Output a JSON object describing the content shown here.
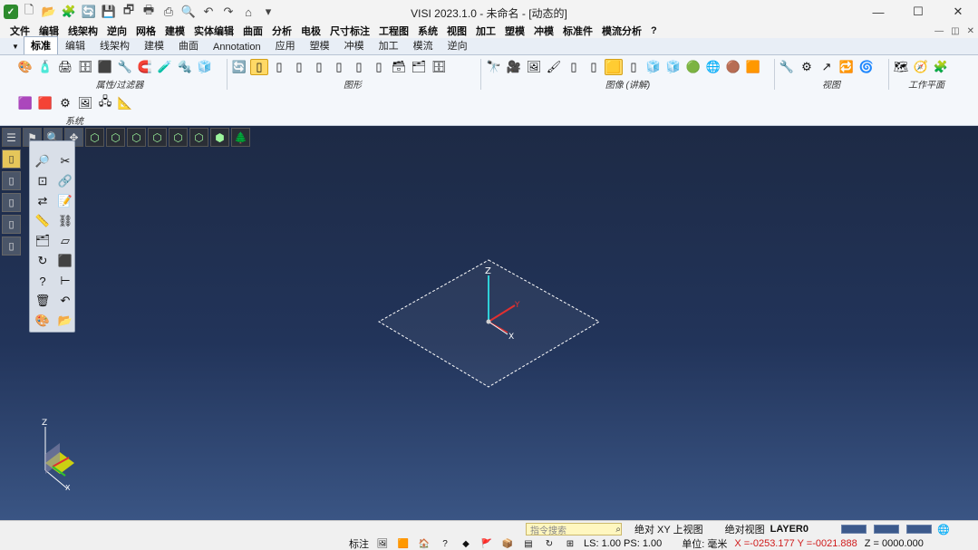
{
  "window": {
    "title": "VISI 2023.1.0 - 未命名 - [动态的]",
    "minimize_glyph": "—",
    "maximize_glyph": "☐",
    "close_glyph": "✕",
    "app_logo_glyph": "✓"
  },
  "quick_access": [
    {
      "name": "new-file-icon",
      "glyph": "🗋"
    },
    {
      "name": "open-icon",
      "glyph": "📂"
    },
    {
      "name": "import-icon",
      "glyph": "🧩"
    },
    {
      "name": "recent-icon",
      "glyph": "🔄"
    },
    {
      "name": "save-icon",
      "glyph": "💾"
    },
    {
      "name": "save-as-icon",
      "glyph": "🗗"
    },
    {
      "name": "print-icon",
      "glyph": "🖶"
    },
    {
      "name": "print-preview-icon",
      "glyph": "⎙"
    },
    {
      "name": "search-icon",
      "glyph": "🔍"
    },
    {
      "name": "undo-icon",
      "glyph": "↶"
    },
    {
      "name": "redo-icon",
      "glyph": "↷"
    },
    {
      "name": "home-icon",
      "glyph": "⌂"
    },
    {
      "name": "customize-icon",
      "glyph": "▾"
    }
  ],
  "menu": [
    "文件",
    "编辑",
    "线架构",
    "逆向",
    "网格",
    "建模",
    "实体编辑",
    "曲面",
    "分析",
    "电极",
    "尺寸标注",
    "工程图",
    "系统",
    "视图",
    "加工",
    "塑模",
    "冲模",
    "标准件",
    "模流分析",
    "?"
  ],
  "mdi_controls": [
    "—",
    "◫",
    "✕"
  ],
  "tabs": {
    "dropdown_glyph": "▼",
    "items": [
      "标准",
      "编辑",
      "线架构",
      "建模",
      "曲面",
      "Annotation",
      "应用",
      "塑模",
      "冲模",
      "加工",
      "模流",
      "逆向"
    ],
    "active_index": 0
  },
  "ribbon": {
    "groups": [
      {
        "label": "属性/过滤器",
        "icons": [
          "🎨",
          "🧴",
          "🖨",
          "🗄",
          "⬛",
          "🔧",
          "🧲",
          "🧪",
          "🔩",
          "🧊"
        ]
      },
      {
        "label": "图形",
        "icons": [
          "🔄",
          "▯",
          "▯",
          "▯",
          "▯",
          "▯",
          "▯",
          "▯",
          "🗃",
          "🗂",
          "🗄"
        ]
      },
      {
        "label": "图像 (讲解)",
        "icons": [
          "🔭",
          "🎥",
          "🖼",
          "🖌",
          "▯",
          "▯",
          "🟨",
          "▯",
          "🧊",
          "🧊",
          "🟢",
          "🌐",
          "🟤",
          "🟧"
        ]
      },
      {
        "label": "视图",
        "icons": [
          "🔧",
          "⚙",
          "↗",
          "🔁",
          "🌀"
        ]
      },
      {
        "label": "工作平面",
        "icons": [
          "🗺",
          "🧭",
          "🧩"
        ]
      }
    ],
    "system_group": {
      "label": "系统",
      "icons": [
        "🟪",
        "🟥",
        "⚙",
        "🖼",
        "🖧",
        "📐"
      ]
    }
  },
  "viewport": {
    "toolbar_icons": [
      {
        "name": "viewport-menu-icon",
        "glyph": "☰"
      },
      {
        "name": "flag-icon",
        "glyph": "⚑"
      },
      {
        "name": "zoom-icon",
        "glyph": "🔍"
      },
      {
        "name": "pan-icon",
        "glyph": "✥"
      },
      {
        "name": "view-top-icon",
        "glyph": "⬡"
      },
      {
        "name": "view-front-icon",
        "glyph": "⬡"
      },
      {
        "name": "view-side-icon",
        "glyph": "⬡"
      },
      {
        "name": "view-iso-icon",
        "glyph": "⬡"
      },
      {
        "name": "view-iso2-icon",
        "glyph": "⬡"
      },
      {
        "name": "view-iso3-icon",
        "glyph": "⬡"
      },
      {
        "name": "view-shaded-icon",
        "glyph": "⬢"
      },
      {
        "name": "view-tree-icon",
        "glyph": "🌲"
      }
    ],
    "left_tools": [
      {
        "name": "cylinder-tool-icon",
        "glyph": "▯",
        "selected": true
      },
      {
        "name": "cylinder-edit-icon",
        "glyph": "▯",
        "selected": false
      },
      {
        "name": "cylinder-copy-icon",
        "glyph": "▯",
        "selected": false
      },
      {
        "name": "cylinder-move-icon",
        "glyph": "▯",
        "selected": false
      },
      {
        "name": "cylinder-delete-icon",
        "glyph": "▯",
        "selected": false
      }
    ],
    "palette_icons": [
      {
        "name": "select-icon",
        "glyph": "🔎"
      },
      {
        "name": "cut-icon",
        "glyph": "✂"
      },
      {
        "name": "bounding-box-icon",
        "glyph": "⊡"
      },
      {
        "name": "link-icon",
        "glyph": "🔗"
      },
      {
        "name": "transform-icon",
        "glyph": "⇄"
      },
      {
        "name": "note-icon",
        "glyph": "📝"
      },
      {
        "name": "measure-icon",
        "glyph": "📏"
      },
      {
        "name": "chain-icon",
        "glyph": "⛓"
      },
      {
        "name": "layers-icon",
        "glyph": "🗂"
      },
      {
        "name": "plane-icon",
        "glyph": "▱"
      },
      {
        "name": "rotate-icon",
        "glyph": "↻"
      },
      {
        "name": "box-icon",
        "glyph": "⬛"
      },
      {
        "name": "help-icon",
        "glyph": "?"
      },
      {
        "name": "dimension-icon",
        "glyph": "⊢"
      },
      {
        "name": "trash-icon",
        "glyph": "🗑"
      },
      {
        "name": "undo-palette-icon",
        "glyph": "↶"
      },
      {
        "name": "color-icon",
        "glyph": "🎨"
      },
      {
        "name": "folder-icon",
        "glyph": "📂"
      }
    ],
    "axis_labels": {
      "z": "Z",
      "y": "Y",
      "x": "X"
    },
    "colors": {
      "z_axis": "#2fd0d8",
      "y_axis": "#e03030",
      "x_axis": "#ffffff",
      "plane_edge": "#ffffff"
    }
  },
  "status": {
    "command_search_placeholder": "指令搜索",
    "absolute_xy": "绝对 XY 上视图",
    "absolute_view": "绝对视图",
    "layer": "LAYER0",
    "color_swatches": [
      "#3c5a8c",
      "#3c5a8c",
      "#3c5a8c"
    ],
    "globe_glyph": "🌐",
    "label_left": "标注",
    "ls_ps": "LS: 1.00 PS: 1.00",
    "unit": "单位: 毫米",
    "coords": "X =-0253.177 Y =-0021.888",
    "z_coord": "Z = 0000.000",
    "icons": [
      "🖼",
      "🟧",
      "🏠",
      "?",
      "◆",
      "🚩",
      "📦",
      "▤",
      "↻",
      "⊞"
    ]
  }
}
